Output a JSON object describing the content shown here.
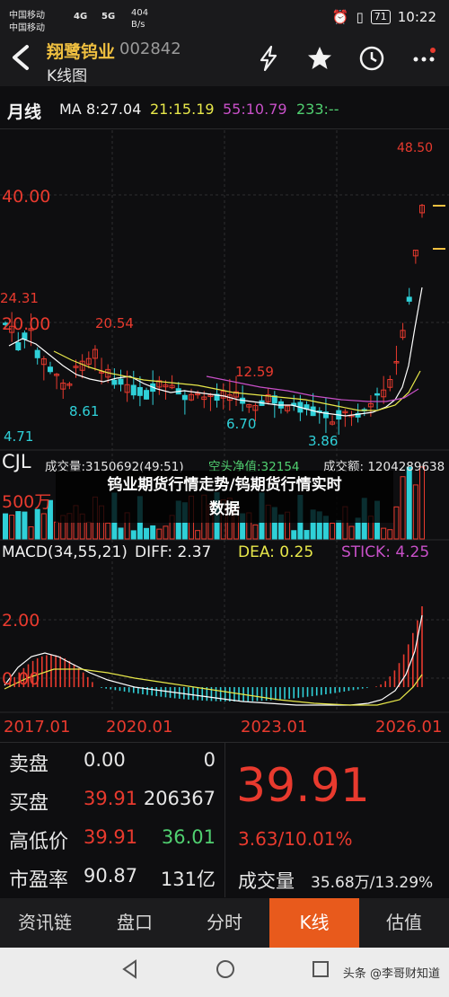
{
  "status": {
    "carrier1": "中国移动",
    "carrier2": "中国移动",
    "net1": "4G",
    "net2": "5G",
    "speed_value": "404",
    "speed_unit": "B/s",
    "battery": "71",
    "time": "10:22"
  },
  "header": {
    "stock_name": "翔鹭钨业",
    "stock_code": "002842",
    "subtitle": "K线图"
  },
  "ma": {
    "period": "月线",
    "ma_label": "MA",
    "ma1": "8:27.04",
    "ma2": "21:15.19",
    "ma3": "55:10.79",
    "ma4": "233:--"
  },
  "chart_labels": {
    "price_high": "48.50",
    "price_40": "40.00",
    "price_24": "24.31",
    "price_20": "20.00",
    "price_2054": "20.54",
    "price_1259": "12.59",
    "price_861": "8.61",
    "price_670": "6.70",
    "price_471": "4.71",
    "price_386": "3.86",
    "vol_500": "500万",
    "macd_200": "2.00",
    "macd_000": "0.00",
    "x_2017": "2017.01",
    "x_2020": "2020.01",
    "x_2023": "2023.01",
    "x_2026": "2026.01"
  },
  "volume": {
    "title": "CJL",
    "vol": "成交量:3150692(49:51)",
    "net": "空头净值:32154",
    "amount": "成交额: 1204289638"
  },
  "caption": {
    "line1": "钨业期货行情走势/钨期货行情实时",
    "line2": "数据"
  },
  "macd": {
    "title": "MACD(34,55,21)",
    "diff": "DIFF: 2.37",
    "dea": "DEA: 0.25",
    "stick": "STICK: 4.25"
  },
  "quote": {
    "sell_label": "卖盘",
    "sell_price": "0.00",
    "sell_qty": "0",
    "buy_label": "买盘",
    "buy_price": "39.91",
    "buy_qty": "206367",
    "hl_label": "高低价",
    "high": "39.91",
    "low": "36.01",
    "pe_label": "市盈率",
    "pe": "90.87",
    "mcap": "131亿",
    "last": "39.91",
    "change": "3.63/10.01%",
    "turnover_label": "成交量",
    "turnover": "35.68万/13.29%"
  },
  "tabs": [
    "资讯链",
    "盘口",
    "分时",
    "K线",
    "估值"
  ],
  "watermark": "头条 @李哥财知道",
  "colors": {
    "up": "#e83a2e",
    "down": "#2fd0d8",
    "accent": "#e85a1c",
    "ma1": "#ffffff",
    "ma2": "#e8e84a",
    "ma3": "#c850c8"
  }
}
